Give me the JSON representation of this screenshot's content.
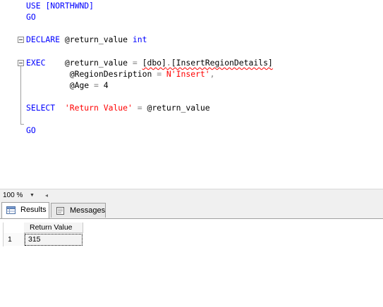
{
  "editor": {
    "lines": {
      "use_kw": "USE",
      "use_db": "[NORTHWND]",
      "go1": "GO",
      "declare_kw": "DECLARE",
      "declare_var": "@return_value",
      "declare_type": "int",
      "exec_kw": "EXEC",
      "exec_var": "@return_value",
      "exec_eq": "=",
      "exec_schema": "[dbo]",
      "exec_dot": ".",
      "exec_proc": "[InsertRegionDetails]",
      "p1_name": "@RegionDesription",
      "p1_eq": "=",
      "p1_val": "N'Insert'",
      "p1_comma": ",",
      "p2_name": "@Age",
      "p2_eq": "=",
      "p2_val": "4",
      "select_kw": "SELECT",
      "select_str": "'Return Value'",
      "select_eq": "=",
      "select_var": "@return_value",
      "go2": "GO"
    }
  },
  "zoom": {
    "value": "100 %"
  },
  "tabs": {
    "results_label": "Results",
    "messages_label": "Messages"
  },
  "grid": {
    "column_header": "Return Value",
    "row_number": "1",
    "cell_value": "315"
  },
  "colors": {
    "keyword": "#0000ff",
    "string": "#ff0000",
    "operator": "#808080",
    "change_bar": "#ffee62"
  }
}
